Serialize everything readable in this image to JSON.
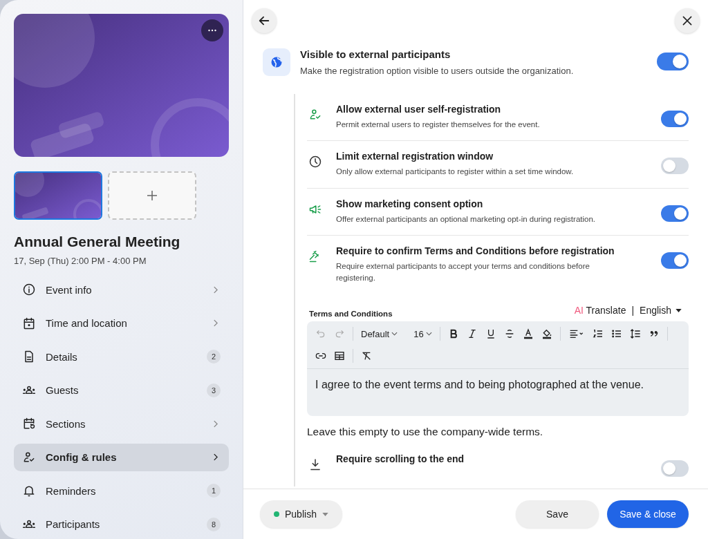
{
  "event": {
    "title": "Annual General Meeting",
    "datetime": "17, Sep (Thu) 2:00 PM - 4:00 PM"
  },
  "thumbnails": [
    {
      "kind": "picture",
      "selected": true
    },
    {
      "kind": "add"
    }
  ],
  "nav": [
    {
      "label": "Event info",
      "selected": false
    },
    {
      "label": "Time and location",
      "selected": false
    },
    {
      "label": "Details",
      "count": "2",
      "selected": false
    },
    {
      "label": "Guests",
      "count": "3",
      "selected": false
    },
    {
      "label": "Sections",
      "selected": false
    },
    {
      "label": "Config & rules",
      "selected": true
    },
    {
      "label": "Reminders",
      "count": "1",
      "selected": false
    },
    {
      "label": "Participants",
      "count": "8",
      "selected": false
    }
  ],
  "visibility": {
    "title": "Visible to external participants",
    "description": "Make the registration option visible to users outside the organization.",
    "on": true
  },
  "options": [
    {
      "title": "Allow external user self-registration",
      "description": "Permit external users to register themselves for the event.",
      "on": true
    },
    {
      "title": "Limit external registration window",
      "description": "Only allow external participants to register within a set time window.",
      "on": false
    },
    {
      "title": "Show marketing consent option",
      "description": "Offer external participants an optional marketing opt-in during registration.",
      "on": true
    },
    {
      "title": "Require to confirm Terms and Conditions before registration",
      "description": "Require external participants to accept your terms and conditions before registering.",
      "on": true
    }
  ],
  "terms": {
    "label": "Terms and Conditions",
    "ai": "AI",
    "translate": "Translate",
    "separator": "|",
    "language": "English",
    "font": "Default",
    "size": "16",
    "can_undo": false,
    "can_redo": false,
    "text": "I agree to the event terms and to being photographed at the venue.",
    "hint": "Leave this empty to use the company-wide terms."
  },
  "scroll_option": {
    "title": "Require scrolling to the end",
    "on": false
  },
  "footer": {
    "status": {
      "label": "Publish",
      "color": "#22b573"
    },
    "save": "Save",
    "save_close": "Save & close"
  }
}
